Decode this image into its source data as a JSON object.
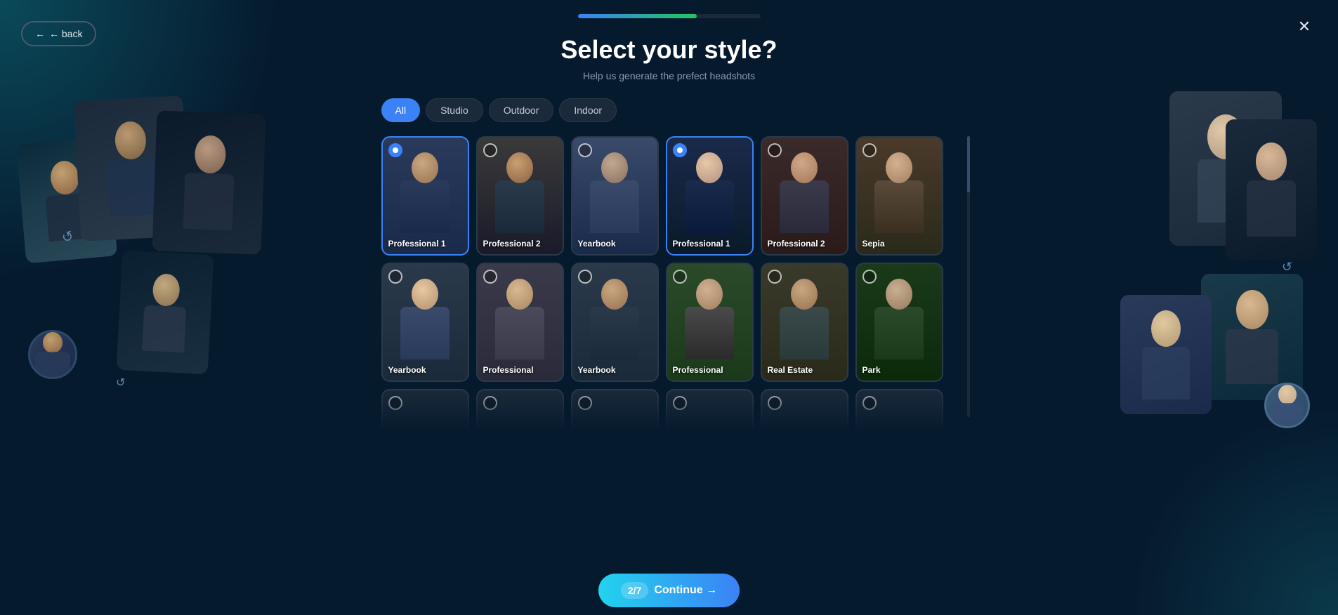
{
  "progress": {
    "fill_percent": 65,
    "color_start": "#3b82f6",
    "color_end": "#22c55e"
  },
  "back_button": {
    "label": "← back"
  },
  "close_button": {
    "label": "✕"
  },
  "title": "Select your style?",
  "subtitle": "Help us generate the prefect headshots",
  "filters": [
    {
      "label": "All",
      "active": true
    },
    {
      "label": "Studio",
      "active": false
    },
    {
      "label": "Outdoor",
      "active": false
    },
    {
      "label": "Indoor",
      "active": false
    }
  ],
  "style_cards_row1": [
    {
      "label": "Professional 1",
      "selected": true,
      "bg_class": "bg-pro1-male",
      "person_class": "c1",
      "radio": "selected"
    },
    {
      "label": "Professional 2",
      "selected": false,
      "bg_class": "bg-pro2-male",
      "person_class": "c2",
      "radio": "unselected"
    },
    {
      "label": "Yearbook",
      "selected": false,
      "bg_class": "bg-yearbook-male",
      "person_class": "c3",
      "radio": "unselected"
    },
    {
      "label": "Professional 1",
      "selected": true,
      "bg_class": "bg-pro1-female",
      "person_class": "c4",
      "radio": "selected"
    },
    {
      "label": "Professional 2",
      "selected": false,
      "bg_class": "bg-pro2-female",
      "person_class": "c5",
      "radio": "unselected"
    },
    {
      "label": "Sepia",
      "selected": false,
      "bg_class": "bg-sepia",
      "person_class": "c6",
      "radio": "unselected"
    }
  ],
  "style_cards_row2": [
    {
      "label": "Yearbook",
      "selected": false,
      "bg_class": "bg-yearbook-female",
      "person_class": "c7",
      "radio": "unselected"
    },
    {
      "label": "Professional",
      "selected": false,
      "bg_class": "bg-professional-female",
      "person_class": "c8",
      "radio": "unselected"
    },
    {
      "label": "Yearbook",
      "selected": false,
      "bg_class": "bg-yearbook-female2",
      "person_class": "c9",
      "radio": "unselected"
    },
    {
      "label": "Professional",
      "selected": false,
      "bg_class": "bg-professional-outdoor",
      "person_class": "c10",
      "radio": "unselected"
    },
    {
      "label": "Real Estate",
      "selected": false,
      "bg_class": "bg-real-estate",
      "person_class": "c11",
      "radio": "unselected"
    },
    {
      "label": "Park",
      "selected": false,
      "bg_class": "bg-park",
      "person_class": "c12",
      "radio": "unselected"
    }
  ],
  "style_cards_row3": [
    {
      "label": "",
      "bg_class": "bg-pro1-male",
      "person_class": "c13"
    },
    {
      "label": "",
      "bg_class": "bg-park",
      "person_class": "c14"
    },
    {
      "label": "",
      "bg_class": "bg-yearbook-male",
      "person_class": "c15"
    },
    {
      "label": "",
      "bg_class": "bg-pro2-male",
      "person_class": "c16"
    },
    {
      "label": "",
      "bg_class": "bg-pro1-female",
      "person_class": "c17"
    },
    {
      "label": "",
      "bg_class": "bg-real-estate",
      "person_class": "c18"
    }
  ],
  "continue_button": {
    "step": "2/7",
    "label": "Continue →"
  }
}
